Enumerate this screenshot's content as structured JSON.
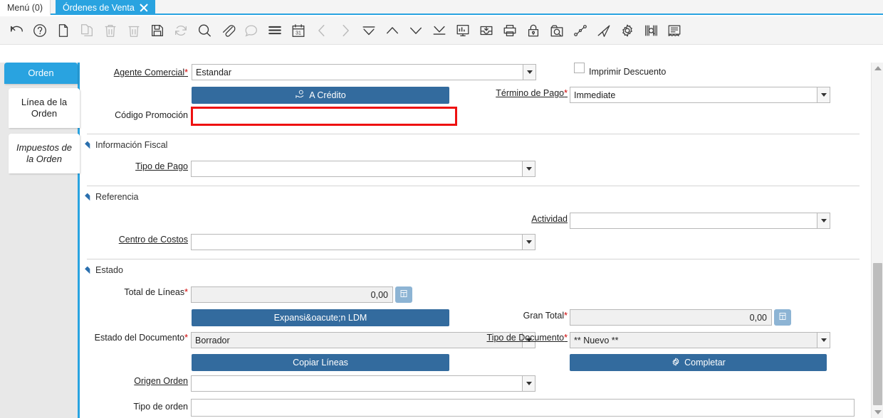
{
  "window": {
    "tabs": [
      {
        "label": "Menú (0)",
        "active": false,
        "closable": false
      },
      {
        "label": "Órdenes de Venta",
        "active": true,
        "closable": true
      }
    ]
  },
  "toolbar": {
    "buttons": [
      {
        "name": "undo-icon",
        "title": "Deshacer",
        "enabled": true
      },
      {
        "name": "help-icon",
        "title": "Ayuda",
        "enabled": true
      },
      {
        "name": "new-record-icon",
        "title": "Nuevo",
        "enabled": true
      },
      {
        "name": "copy-record-icon",
        "title": "Copiar",
        "enabled": false
      },
      {
        "name": "delete-record-icon",
        "title": "Eliminar",
        "enabled": false
      },
      {
        "name": "delete-selection-icon",
        "title": "Eliminar selección",
        "enabled": false
      },
      {
        "name": "save-icon",
        "title": "Guardar",
        "enabled": true
      },
      {
        "name": "refresh-icon",
        "title": "Refrescar",
        "enabled": false
      },
      {
        "name": "search-icon",
        "title": "Buscar",
        "enabled": true
      },
      {
        "name": "attachment-icon",
        "title": "Adjunto",
        "enabled": true
      },
      {
        "name": "chat-icon",
        "title": "Comentarios",
        "enabled": false
      },
      {
        "name": "grid-toggle-icon",
        "title": "Vista de cuadrícula",
        "enabled": true
      },
      {
        "name": "calendar-icon",
        "title": "Calendario",
        "enabled": true
      },
      {
        "name": "previous-record-icon",
        "title": "Anterior",
        "enabled": false
      },
      {
        "name": "next-record-icon",
        "title": "Siguiente",
        "enabled": false
      },
      {
        "name": "first-record-icon",
        "title": "Primero",
        "enabled": true
      },
      {
        "name": "up-record-icon",
        "title": "Arriba",
        "enabled": true
      },
      {
        "name": "down-record-icon",
        "title": "Abajo",
        "enabled": true
      },
      {
        "name": "last-record-icon",
        "title": "Último",
        "enabled": true
      },
      {
        "name": "report-icon",
        "title": "Reporte",
        "enabled": true
      },
      {
        "name": "archive-icon",
        "title": "Archivar",
        "enabled": true
      },
      {
        "name": "print-icon",
        "title": "Imprimir",
        "enabled": true
      },
      {
        "name": "lock-icon",
        "title": "Bloquear",
        "enabled": true
      },
      {
        "name": "zoom-across-icon",
        "title": "Zoom",
        "enabled": true
      },
      {
        "name": "workflow-icon",
        "title": "Flujo de trabajo",
        "enabled": true
      },
      {
        "name": "send-icon",
        "title": "Enviar",
        "enabled": true
      },
      {
        "name": "settings-icon",
        "title": "Preferencias",
        "enabled": true
      },
      {
        "name": "barcode-icon",
        "title": "Código de barras",
        "enabled": true
      },
      {
        "name": "document-icon",
        "title": "Documento",
        "enabled": true
      }
    ]
  },
  "side_tabs": [
    {
      "label": "Orden",
      "selected": true
    },
    {
      "label": "Línea de la Orden",
      "selected": false
    },
    {
      "label": "Impuestos de la Orden",
      "selected": false
    }
  ],
  "form": {
    "agente_comercial": {
      "label": "Agente Comercial",
      "required": true,
      "value": "Estandar",
      "placeholder": ""
    },
    "a_credito_button": {
      "label": "A Crédito",
      "icon": "hand-coin-icon"
    },
    "codigo_promocion": {
      "label": "Código Promoción",
      "required": false,
      "value": "",
      "placeholder": "",
      "highlighted": true
    },
    "imprimir_descuento": {
      "label": "Imprimir Descuento",
      "checked": false
    },
    "termino_de_pago": {
      "label": "Término de Pago",
      "required": true,
      "value": "Immediate",
      "placeholder": ""
    },
    "sections": [
      {
        "key": "informacion_fiscal",
        "label": "Información Fiscal",
        "expanded": true
      },
      {
        "key": "referencia",
        "label": "Referencia",
        "expanded": true
      },
      {
        "key": "estado",
        "label": "Estado",
        "expanded": true
      }
    ],
    "tipo_de_pago": {
      "label": "Tipo de Pago",
      "required": false,
      "value": "",
      "placeholder": ""
    },
    "actividad": {
      "label": "Actividad",
      "required": false,
      "value": "",
      "placeholder": ""
    },
    "centro_de_costos": {
      "label": "Centro de Costos",
      "required": false,
      "value": "",
      "placeholder": ""
    },
    "total_de_lineas": {
      "label": "Total de Líneas",
      "required": true,
      "value": "0,00",
      "readonly": true,
      "calc_icon": "calculator-icon"
    },
    "gran_total": {
      "label": "Gran Total",
      "required": true,
      "value": "0,00",
      "readonly": true,
      "calc_icon": "calculator-icon"
    },
    "expansion_ldm_button": {
      "label": "Expansi&oacute;n LDM"
    },
    "estado_del_documento": {
      "label": "Estado del Documento",
      "required": true,
      "value": "Borrador",
      "readonly": true
    },
    "tipo_de_documento": {
      "label": "Tipo de Documento",
      "required": true,
      "value": "** Nuevo **",
      "readonly": true
    },
    "completar_button": {
      "label": "Completar",
      "icon": "gear-icon"
    },
    "copiar_lineas_button": {
      "label": "Copiar Líneas"
    },
    "origen_orden": {
      "label": "Origen Orden",
      "required": false,
      "value": "",
      "placeholder": ""
    },
    "tipo_de_orden": {
      "label": "Tipo de orden",
      "required": false,
      "value": "",
      "placeholder": ""
    }
  },
  "scrollbar": {
    "name": "vertical-scrollbar",
    "orientation": "vertical"
  },
  "colors": {
    "accent_blue": "#29a3e0",
    "button_blue": "#336b9e",
    "calc_blue": "#8db4d4",
    "highlight_red": "#ee1111",
    "required_red": "#d00000",
    "rail_gray": "#e8e8e8"
  }
}
